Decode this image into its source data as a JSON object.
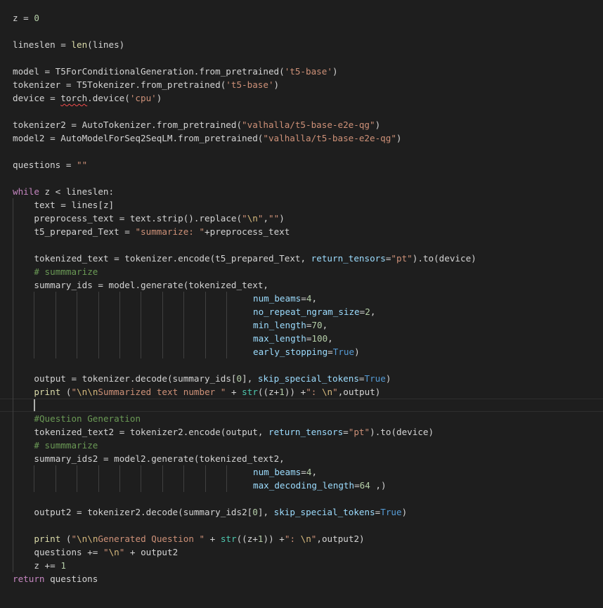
{
  "editor": {
    "lines": [
      {
        "indent": 0,
        "tokens": [
          {
            "t": "z = "
          },
          {
            "t": "0",
            "c": "num"
          }
        ]
      },
      {
        "indent": 0,
        "tokens": []
      },
      {
        "indent": 0,
        "tokens": [
          {
            "t": "lineslen = "
          },
          {
            "t": "len",
            "c": "fn"
          },
          {
            "t": "(lines)"
          }
        ]
      },
      {
        "indent": 0,
        "tokens": []
      },
      {
        "indent": 0,
        "tokens": [
          {
            "t": "model = T5ForConditionalGeneration.from_pretrained("
          },
          {
            "t": "'t5-base'",
            "c": "str"
          },
          {
            "t": ")"
          }
        ]
      },
      {
        "indent": 0,
        "tokens": [
          {
            "t": "tokenizer = T5Tokenizer.from_pretrained("
          },
          {
            "t": "'t5-base'",
            "c": "str"
          },
          {
            "t": ")"
          }
        ]
      },
      {
        "indent": 0,
        "tokens": [
          {
            "t": "device = "
          },
          {
            "t": "torch",
            "u": true
          },
          {
            "t": ".device("
          },
          {
            "t": "'cpu'",
            "c": "str"
          },
          {
            "t": ")"
          }
        ]
      },
      {
        "indent": 0,
        "tokens": []
      },
      {
        "indent": 0,
        "tokens": [
          {
            "t": "tokenizer2 = AutoTokenizer.from_pretrained("
          },
          {
            "t": "\"valhalla/t5-base-e2e-qg\"",
            "c": "str"
          },
          {
            "t": ")"
          }
        ]
      },
      {
        "indent": 0,
        "tokens": [
          {
            "t": "model2 = AutoModelForSeq2SeqLM.from_pretrained("
          },
          {
            "t": "\"valhalla/t5-base-e2e-qg\"",
            "c": "str"
          },
          {
            "t": ")"
          }
        ]
      },
      {
        "indent": 0,
        "tokens": []
      },
      {
        "indent": 0,
        "tokens": [
          {
            "t": "questions = "
          },
          {
            "t": "\"\"",
            "c": "str"
          }
        ]
      },
      {
        "indent": 0,
        "tokens": []
      },
      {
        "indent": 0,
        "tokens": [
          {
            "t": "while",
            "c": "kw"
          },
          {
            "t": " z < lineslen:"
          }
        ]
      },
      {
        "indent": 1,
        "tokens": [
          {
            "t": "text = lines[z]"
          }
        ]
      },
      {
        "indent": 1,
        "tokens": [
          {
            "t": "preprocess_text = text.strip().replace("
          },
          {
            "t": "\"",
            "c": "str"
          },
          {
            "t": "\\n",
            "c": "esc"
          },
          {
            "t": "\"",
            "c": "str"
          },
          {
            "t": ","
          },
          {
            "t": "\"\"",
            "c": "str"
          },
          {
            "t": ")"
          }
        ]
      },
      {
        "indent": 1,
        "tokens": [
          {
            "t": "t5_prepared_Text = "
          },
          {
            "t": "\"summarize: \"",
            "c": "str"
          },
          {
            "t": "+preprocess_text"
          }
        ]
      },
      {
        "indent": 1,
        "tokens": []
      },
      {
        "indent": 1,
        "tokens": [
          {
            "t": "tokenized_text = tokenizer.encode(t5_prepared_Text, "
          },
          {
            "t": "return_tensors",
            "c": "param"
          },
          {
            "t": "="
          },
          {
            "t": "\"pt\"",
            "c": "str"
          },
          {
            "t": ").to(device)"
          }
        ]
      },
      {
        "indent": 1,
        "tokens": [
          {
            "t": "# summmarize",
            "c": "cmt"
          }
        ]
      },
      {
        "indent": 1,
        "tokens": [
          {
            "t": "summary_ids = model.generate(tokenized_text,"
          }
        ]
      },
      {
        "indent": 1,
        "cont": 10,
        "tokens": [
          {
            "t": "num_beams",
            "c": "param"
          },
          {
            "t": "="
          },
          {
            "t": "4",
            "c": "num"
          },
          {
            "t": ","
          }
        ]
      },
      {
        "indent": 1,
        "cont": 10,
        "tokens": [
          {
            "t": "no_repeat_ngram_size",
            "c": "param"
          },
          {
            "t": "="
          },
          {
            "t": "2",
            "c": "num"
          },
          {
            "t": ","
          }
        ]
      },
      {
        "indent": 1,
        "cont": 10,
        "tokens": [
          {
            "t": "min_length",
            "c": "param"
          },
          {
            "t": "="
          },
          {
            "t": "70",
            "c": "num"
          },
          {
            "t": ","
          }
        ]
      },
      {
        "indent": 1,
        "cont": 10,
        "tokens": [
          {
            "t": "max_length",
            "c": "param"
          },
          {
            "t": "="
          },
          {
            "t": "100",
            "c": "num"
          },
          {
            "t": ","
          }
        ]
      },
      {
        "indent": 1,
        "cont": 10,
        "tokens": [
          {
            "t": "early_stopping",
            "c": "param"
          },
          {
            "t": "="
          },
          {
            "t": "True",
            "c": "const"
          },
          {
            "t": ")"
          }
        ]
      },
      {
        "indent": 1,
        "tokens": []
      },
      {
        "indent": 1,
        "tokens": [
          {
            "t": "output = tokenizer.decode(summary_ids["
          },
          {
            "t": "0",
            "c": "num"
          },
          {
            "t": "], "
          },
          {
            "t": "skip_special_tokens",
            "c": "param"
          },
          {
            "t": "="
          },
          {
            "t": "True",
            "c": "const"
          },
          {
            "t": ")"
          }
        ]
      },
      {
        "indent": 1,
        "tokens": [
          {
            "t": "print",
            "c": "fn"
          },
          {
            "t": " ("
          },
          {
            "t": "\"",
            "c": "str"
          },
          {
            "t": "\\n\\n",
            "c": "esc"
          },
          {
            "t": "Summarized text number \"",
            "c": "str"
          },
          {
            "t": " + "
          },
          {
            "t": "str",
            "c": "bi"
          },
          {
            "t": "((z+"
          },
          {
            "t": "1",
            "c": "num"
          },
          {
            "t": ")) +"
          },
          {
            "t": "\": ",
            "c": "str"
          },
          {
            "t": "\\n",
            "c": "esc"
          },
          {
            "t": "\"",
            "c": "str"
          },
          {
            "t": ",output)"
          }
        ]
      },
      {
        "indent": 1,
        "cursor": true,
        "tokens": []
      },
      {
        "indent": 1,
        "tokens": [
          {
            "t": "#Question Generation",
            "c": "cmt"
          }
        ]
      },
      {
        "indent": 1,
        "tokens": [
          {
            "t": "tokenized_text2 = tokenizer2.encode(output, "
          },
          {
            "t": "return_tensors",
            "c": "param"
          },
          {
            "t": "="
          },
          {
            "t": "\"pt\"",
            "c": "str"
          },
          {
            "t": ").to(device)"
          }
        ]
      },
      {
        "indent": 1,
        "tokens": [
          {
            "t": "# summmarize",
            "c": "cmt"
          }
        ]
      },
      {
        "indent": 1,
        "tokens": [
          {
            "t": "summary_ids2 = model2.generate(tokenized_text2,"
          }
        ]
      },
      {
        "indent": 1,
        "cont": 10,
        "tokens": [
          {
            "t": "num_beams",
            "c": "param"
          },
          {
            "t": "="
          },
          {
            "t": "4",
            "c": "num"
          },
          {
            "t": ","
          }
        ]
      },
      {
        "indent": 1,
        "cont": 10,
        "tokens": [
          {
            "t": "max_decoding_length",
            "c": "param"
          },
          {
            "t": "="
          },
          {
            "t": "64",
            "c": "num"
          },
          {
            "t": " ,)"
          }
        ]
      },
      {
        "indent": 1,
        "tokens": []
      },
      {
        "indent": 1,
        "tokens": [
          {
            "t": "output2 = tokenizer2.decode(summary_ids2["
          },
          {
            "t": "0",
            "c": "num"
          },
          {
            "t": "], "
          },
          {
            "t": "skip_special_tokens",
            "c": "param"
          },
          {
            "t": "="
          },
          {
            "t": "True",
            "c": "const"
          },
          {
            "t": ")"
          }
        ]
      },
      {
        "indent": 1,
        "tokens": []
      },
      {
        "indent": 1,
        "tokens": [
          {
            "t": "print",
            "c": "fn"
          },
          {
            "t": " ("
          },
          {
            "t": "\"",
            "c": "str"
          },
          {
            "t": "\\n\\n",
            "c": "esc"
          },
          {
            "t": "Generated Question \"",
            "c": "str"
          },
          {
            "t": " + "
          },
          {
            "t": "str",
            "c": "bi"
          },
          {
            "t": "((z+"
          },
          {
            "t": "1",
            "c": "num"
          },
          {
            "t": ")) +"
          },
          {
            "t": "\": ",
            "c": "str"
          },
          {
            "t": "\\n",
            "c": "esc"
          },
          {
            "t": "\"",
            "c": "str"
          },
          {
            "t": ",output2)"
          }
        ]
      },
      {
        "indent": 1,
        "tokens": [
          {
            "t": "questions += "
          },
          {
            "t": "\"",
            "c": "str"
          },
          {
            "t": "\\n",
            "c": "esc"
          },
          {
            "t": "\"",
            "c": "str"
          },
          {
            "t": " + output2"
          }
        ]
      },
      {
        "indent": 1,
        "tokens": [
          {
            "t": "z += "
          },
          {
            "t": "1",
            "c": "num"
          }
        ]
      },
      {
        "indent": 0,
        "tokens": [
          {
            "t": "return",
            "c": "kw"
          },
          {
            "t": " questions"
          }
        ]
      }
    ]
  },
  "colors": {
    "background": "#1e1e1e",
    "text": "#d4d4d4",
    "keyword": "#c586c0",
    "string": "#ce9178",
    "escape": "#d7ba7d",
    "number": "#b5cea8",
    "comment": "#6a9955",
    "parameter": "#9cdcfe",
    "function": "#dcdcaa",
    "builtin": "#4ec9b0",
    "constant": "#569cd6",
    "error_squiggle": "#f14c4c"
  }
}
